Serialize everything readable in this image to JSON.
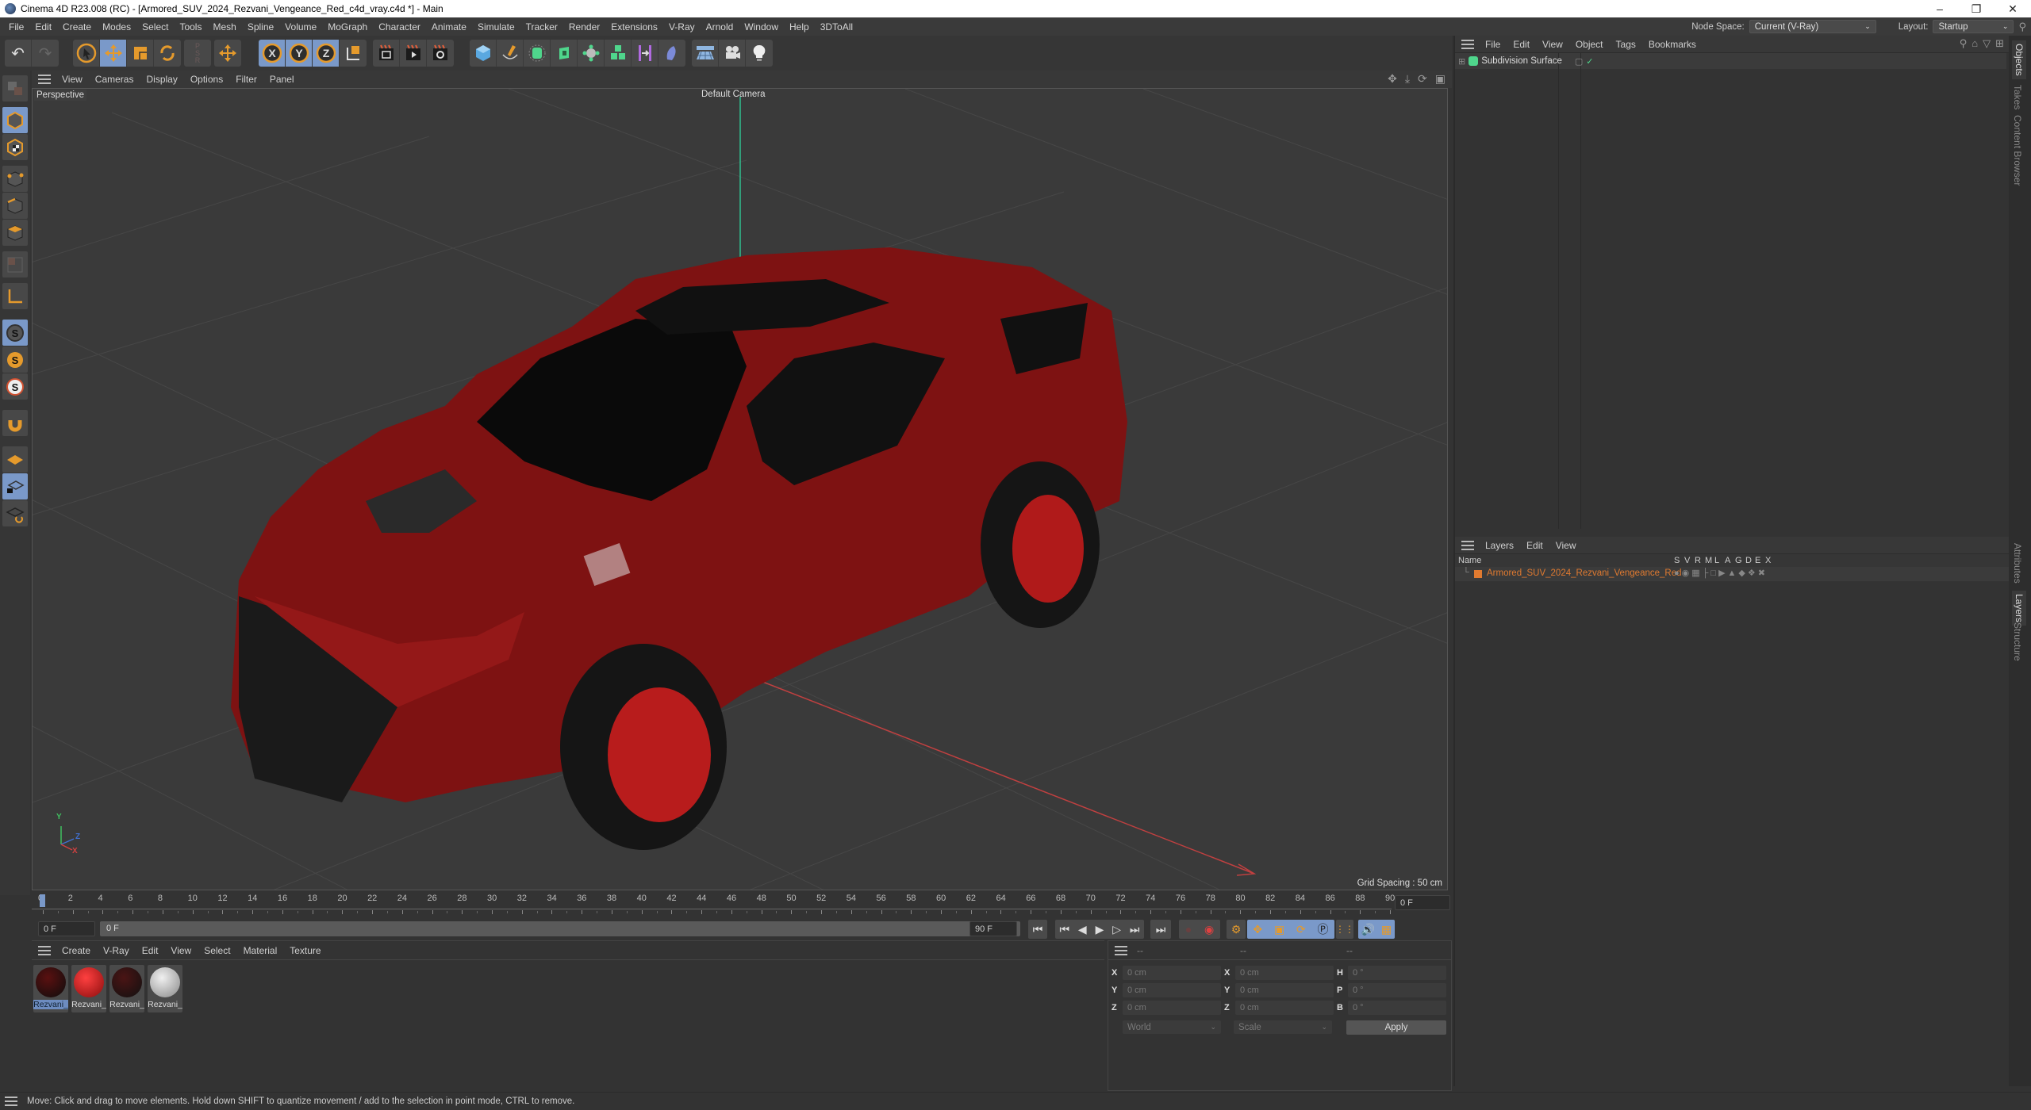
{
  "window": {
    "title": "Cinema 4D R23.008 (RC) - [Armored_SUV_2024_Rezvani_Vengeance_Red_c4d_vray.c4d *] - Main",
    "controls": {
      "minimize": "–",
      "restore": "❐",
      "close": "✕"
    }
  },
  "menubar": {
    "items": [
      "File",
      "Edit",
      "Create",
      "Modes",
      "Select",
      "Tools",
      "Mesh",
      "Spline",
      "Volume",
      "MoGraph",
      "Character",
      "Animate",
      "Simulate",
      "Tracker",
      "Render",
      "Extensions",
      "V-Ray",
      "Arnold",
      "Window",
      "Help",
      "3DToAll"
    ],
    "node_space_label": "Node Space:",
    "node_space_value": "Current (V-Ray)",
    "layout_label": "Layout:",
    "layout_value": "Startup"
  },
  "toolbar": {
    "groups": [
      [
        "undo-icon",
        "redo-icon"
      ],
      [
        "live-selection-icon",
        "move-icon",
        "scale-icon",
        "rotate-icon"
      ],
      [
        "psr-icon"
      ],
      [
        "world-axis-icon"
      ],
      [
        "x-axis-lock-icon",
        "y-axis-lock-icon",
        "z-axis-lock-icon",
        "coordinate-system-icon"
      ],
      [
        "render-view-icon",
        "render-picture-viewer-icon",
        "render-settings-icon"
      ],
      [
        "cube-icon",
        "pen-icon",
        "subdivision-icon",
        "extrude-icon",
        "mograph-cloner-icon",
        "array-icon",
        "deformer-icon",
        "field-icon"
      ],
      [
        "floor-icon",
        "camera-icon",
        "light-icon"
      ]
    ]
  },
  "viewport": {
    "menu": [
      "View",
      "Cameras",
      "Display",
      "Options",
      "Filter",
      "Panel"
    ],
    "projection": "Perspective",
    "camera": "Default Camera",
    "grid_spacing": "Grid Spacing : 50 cm",
    "axes": {
      "x": "X",
      "y": "Y",
      "z": "Z"
    },
    "colors": {
      "background": "#3a3a3a",
      "car_body": "#8c1414",
      "car_dark": "#1a1a1a",
      "x_axis": "#d04040",
      "y_axis": "#40c060",
      "z_axis": "#4070d0"
    }
  },
  "timeline": {
    "ticks": [
      "0",
      "2",
      "4",
      "6",
      "8",
      "10",
      "12",
      "14",
      "16",
      "18",
      "20",
      "22",
      "24",
      "26",
      "28",
      "30",
      "32",
      "34",
      "36",
      "38",
      "40",
      "42",
      "44",
      "46",
      "48",
      "50",
      "52",
      "54",
      "56",
      "58",
      "60",
      "62",
      "64",
      "66",
      "68",
      "70",
      "72",
      "74",
      "76",
      "78",
      "80",
      "82",
      "84",
      "86",
      "88",
      "90"
    ],
    "current_frame": "0 F",
    "start_field": "0 F",
    "range_start": "0 F",
    "range_end": "90 F",
    "end_field": "90 F"
  },
  "materials": {
    "menu": [
      "Create",
      "V-Ray",
      "Edit",
      "View",
      "Select",
      "Material",
      "Texture"
    ],
    "items": [
      {
        "label": "Rezvani_",
        "selected": true,
        "color": "#2a0808"
      },
      {
        "label": "Rezvani_",
        "selected": false,
        "color": "#b01818"
      },
      {
        "label": "Rezvani_",
        "selected": false,
        "color": "#3a0a0a"
      },
      {
        "label": "Rezvani_",
        "selected": false,
        "color": "#c8c8c8"
      }
    ]
  },
  "coordinates": {
    "headers": [
      "--",
      "--",
      "--"
    ],
    "position": [
      {
        "axis": "X",
        "value": "0 cm"
      },
      {
        "axis": "Y",
        "value": "0 cm"
      },
      {
        "axis": "Z",
        "value": "0 cm"
      }
    ],
    "size": [
      {
        "axis": "X",
        "value": "0 cm"
      },
      {
        "axis": "Y",
        "value": "0 cm"
      },
      {
        "axis": "Z",
        "value": "0 cm"
      }
    ],
    "rotation": [
      {
        "axis": "H",
        "value": "0 °"
      },
      {
        "axis": "P",
        "value": "0 °"
      },
      {
        "axis": "B",
        "value": "0 °"
      }
    ],
    "mode_world": "World",
    "mode_scale": "Scale",
    "apply": "Apply"
  },
  "objects": {
    "menu": [
      "File",
      "Edit",
      "View",
      "Object",
      "Tags",
      "Bookmarks"
    ],
    "items": [
      {
        "name": "Subdivision Surface"
      }
    ]
  },
  "layers": {
    "menu": [
      "Layers",
      "Edit",
      "View"
    ],
    "columns": [
      "Name",
      "S",
      "V",
      "R",
      "M",
      "L",
      "A",
      "G",
      "D",
      "E",
      "X"
    ],
    "items": [
      {
        "name": "Armored_SUV_2024_Rezvani_Vengeance_Red",
        "color": "#e07a30"
      }
    ]
  },
  "side_tabs": {
    "top": [
      "Objects",
      "Takes",
      "Content Browser"
    ],
    "bottom": [
      "Attributes",
      "Layers",
      "Structure"
    ]
  },
  "status": {
    "message": "Move: Click and drag to move elements. Hold down SHIFT to quantize movement / add to the selection in point mode, CTRL to remove."
  }
}
